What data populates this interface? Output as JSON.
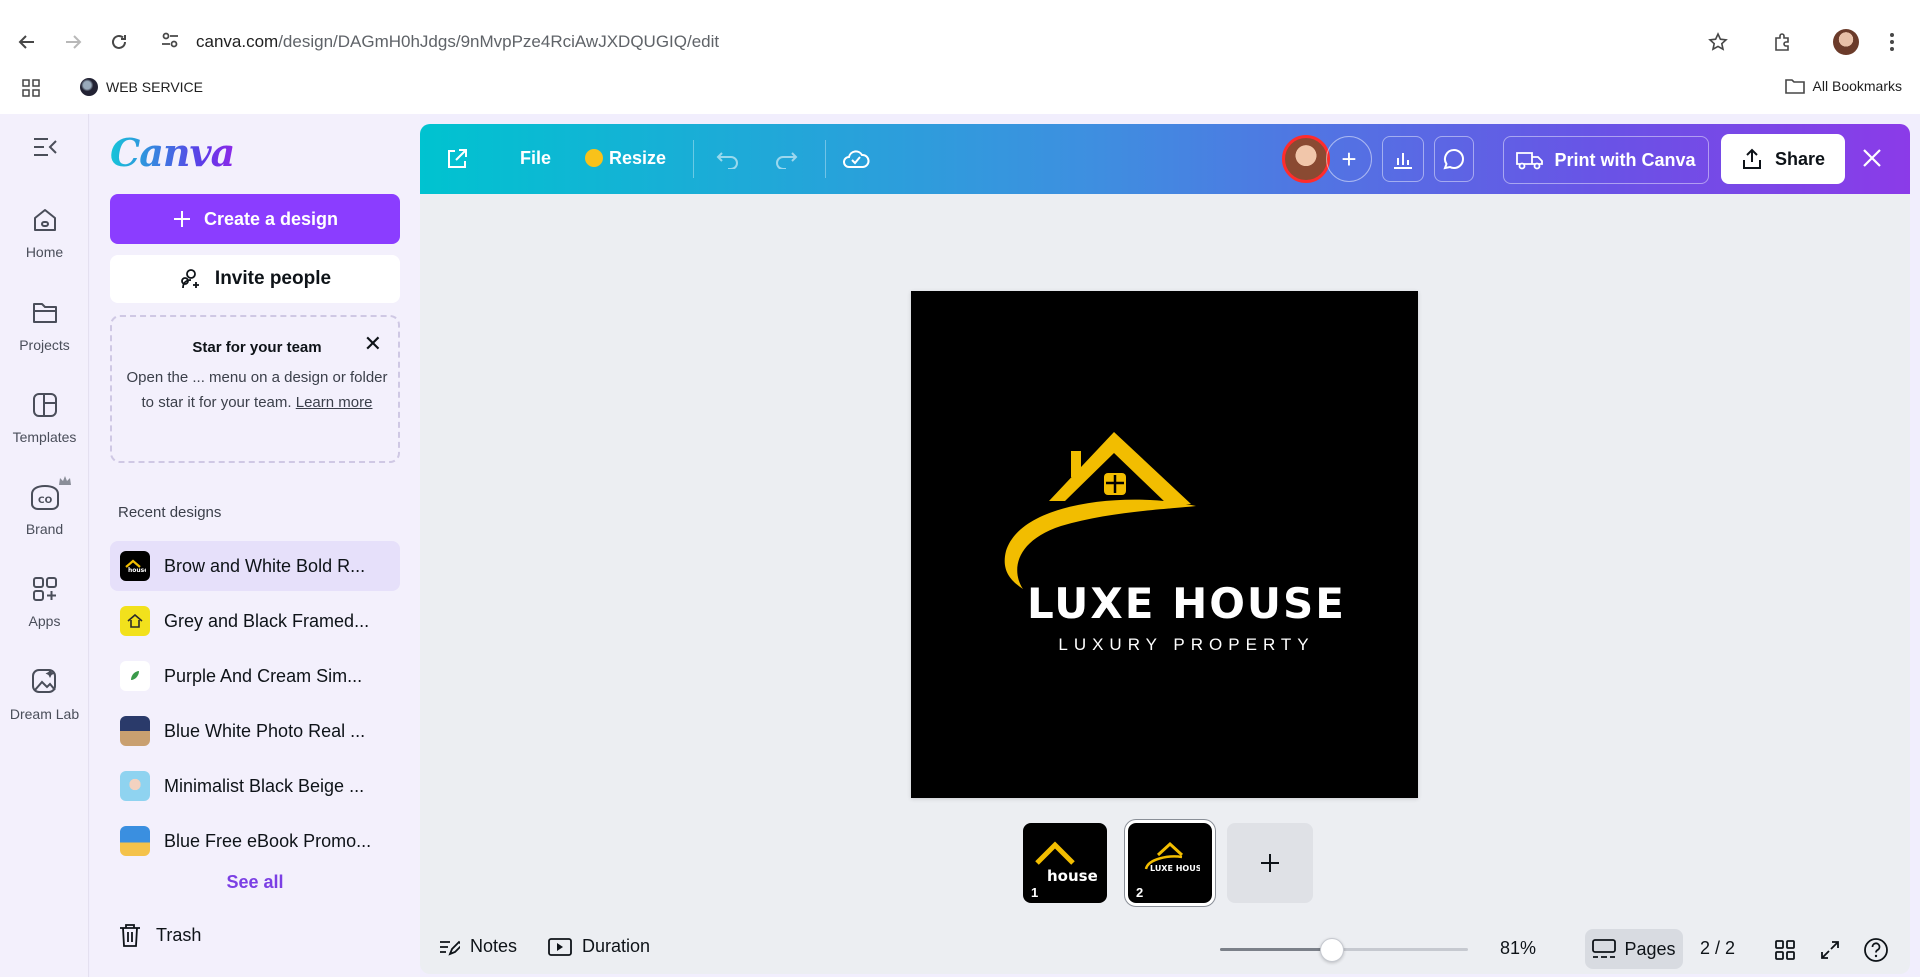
{
  "browser": {
    "url_domain": "canva.com",
    "url_path": "/design/DAGmH0hJdgs/9nMvpPze4RciAwJXDQUGIQ/edit",
    "bookmark_item": "WEB SERVICE",
    "all_bookmarks": "All Bookmarks"
  },
  "rail": {
    "items": [
      {
        "label": "Home",
        "icon": "home-icon"
      },
      {
        "label": "Projects",
        "icon": "folder-icon"
      },
      {
        "label": "Templates",
        "icon": "templates-icon"
      },
      {
        "label": "Brand",
        "icon": "brand-icon"
      },
      {
        "label": "Apps",
        "icon": "apps-icon"
      },
      {
        "label": "Dream Lab",
        "icon": "dream-lab-icon"
      }
    ]
  },
  "sidebar": {
    "logo": "Canva",
    "create_label": "Create a design",
    "invite_label": "Invite people",
    "star_card": {
      "title": "Star for your team",
      "body": "Open the ... menu on a design or folder to star it for your team.",
      "link": "Learn more"
    },
    "recent_title": "Recent designs",
    "recent": [
      {
        "label": "Brow and White Bold R...",
        "active": true,
        "thumb": "#000000"
      },
      {
        "label": "Grey and Black Framed...",
        "active": false,
        "thumb": "#f2e11c"
      },
      {
        "label": "Purple And Cream Sim...",
        "active": false,
        "thumb": "#ffffff"
      },
      {
        "label": "Blue White Photo Real ...",
        "active": false,
        "thumb": "#2a3a6a"
      },
      {
        "label": "Minimalist Black Beige ...",
        "active": false,
        "thumb": "#8fd3f0"
      },
      {
        "label": "Blue Free eBook Promo...",
        "active": false,
        "thumb": "#3a8fe0"
      }
    ],
    "see_all": "See all",
    "trash": "Trash"
  },
  "toolbar": {
    "file_label": "File",
    "resize_label": "Resize",
    "print_label": "Print with Canva",
    "share_label": "Share"
  },
  "canvas": {
    "title": "LUXE HOUSE",
    "subtitle": "LUXURY PROPERTY",
    "background": "#000000",
    "accent": "#f2bd00"
  },
  "pages": {
    "thumbs": [
      {
        "num": "1",
        "caption": "house"
      },
      {
        "num": "2",
        "caption": "LUXE HOUSE"
      }
    ]
  },
  "footer": {
    "notes_label": "Notes",
    "duration_label": "Duration",
    "zoom": "81%",
    "zoom_fraction": 0.45,
    "pages_label": "Pages",
    "page_count": "2 / 2"
  },
  "colors": {
    "brand_purple": "#8b3dff",
    "topbar_start": "#00c3d0",
    "topbar_end": "#8b3be8"
  }
}
